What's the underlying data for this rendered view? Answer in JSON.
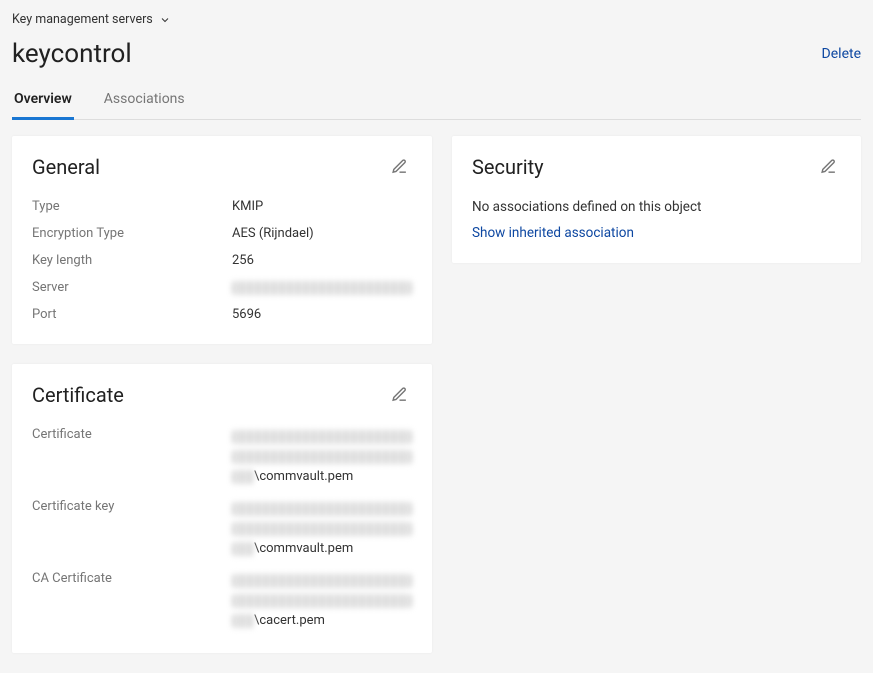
{
  "breadcrumb": {
    "label": "Key management servers"
  },
  "page": {
    "title": "keycontrol"
  },
  "actions": {
    "delete": "Delete"
  },
  "tabs": {
    "overview": "Overview",
    "associations": "Associations",
    "active": "overview"
  },
  "general": {
    "title": "General",
    "rows": {
      "type": {
        "label": "Type",
        "value": "KMIP"
      },
      "encType": {
        "label": "Encryption Type",
        "value": "AES (Rijndael)"
      },
      "keyLength": {
        "label": "Key length",
        "value": "256"
      },
      "server": {
        "label": "Server",
        "value": ""
      },
      "port": {
        "label": "Port",
        "value": "5696"
      }
    }
  },
  "certificate": {
    "title": "Certificate",
    "rows": {
      "cert": {
        "label": "Certificate",
        "suffix": "\\commvault.pem"
      },
      "key": {
        "label": "Certificate key",
        "suffix": "\\commvault.pem"
      },
      "ca": {
        "label": "CA Certificate",
        "suffix": "\\cacert.pem"
      }
    }
  },
  "security": {
    "title": "Security",
    "noAssoc": "No associations defined on this object",
    "showInherited": "Show inherited association"
  }
}
